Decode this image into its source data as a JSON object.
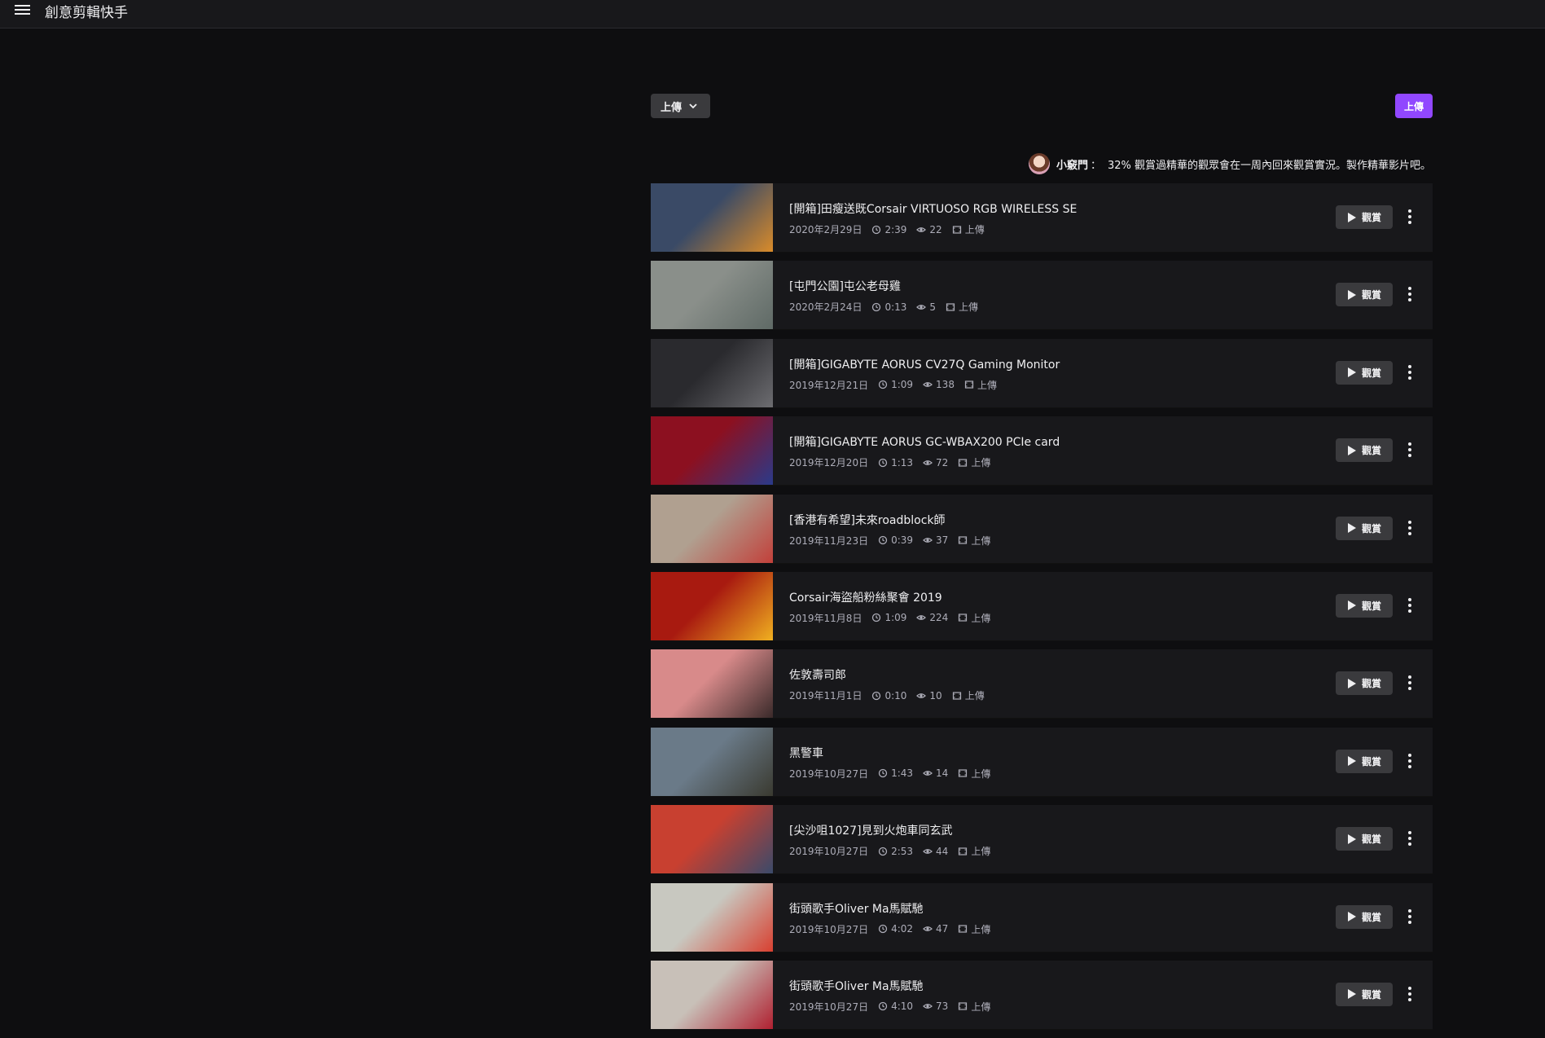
{
  "app": {
    "title": "創意剪輯快手"
  },
  "filter": {
    "label": "上傳"
  },
  "upload_button": {
    "label": "上傳"
  },
  "tip": {
    "name": "小竅門",
    "separator": "：",
    "text": "32% 觀賞過精華的觀眾會在一周內回來觀賞實況。製作精華影片吧。"
  },
  "videos": [
    {
      "title": "[開箱]田瘦送既Corsair VIRTUOSO RGB WIRELESS SE",
      "date": "2020年2月29日",
      "duration": "2:39",
      "views": "22",
      "type": "上傳",
      "watch_label": "觀賞"
    },
    {
      "title": "[屯門公園]屯公老母雞",
      "date": "2020年2月24日",
      "duration": "0:13",
      "views": "5",
      "type": "上傳",
      "watch_label": "觀賞"
    },
    {
      "title": "[開箱]GIGABYTE AORUS CV27Q Gaming Monitor",
      "date": "2019年12月21日",
      "duration": "1:09",
      "views": "138",
      "type": "上傳",
      "watch_label": "觀賞"
    },
    {
      "title": "[開箱]GIGABYTE AORUS GC-WBAX200 PCIe card",
      "date": "2019年12月20日",
      "duration": "1:13",
      "views": "72",
      "type": "上傳",
      "watch_label": "觀賞"
    },
    {
      "title": "[香港有希望]未來roadblock師",
      "date": "2019年11月23日",
      "duration": "0:39",
      "views": "37",
      "type": "上傳",
      "watch_label": "觀賞"
    },
    {
      "title": "Corsair海盜船粉絲聚會 2019",
      "date": "2019年11月8日",
      "duration": "1:09",
      "views": "224",
      "type": "上傳",
      "watch_label": "觀賞"
    },
    {
      "title": "佐敦壽司郎",
      "date": "2019年11月1日",
      "duration": "0:10",
      "views": "10",
      "type": "上傳",
      "watch_label": "觀賞"
    },
    {
      "title": "黑警車",
      "date": "2019年10月27日",
      "duration": "1:43",
      "views": "14",
      "type": "上傳",
      "watch_label": "觀賞"
    },
    {
      "title": "[尖沙咀1027]見到火炮車同玄武",
      "date": "2019年10月27日",
      "duration": "2:53",
      "views": "44",
      "type": "上傳",
      "watch_label": "觀賞"
    },
    {
      "title": "街頭歌手Oliver Ma馬賦馳",
      "date": "2019年10月27日",
      "duration": "4:02",
      "views": "47",
      "type": "上傳",
      "watch_label": "觀賞"
    },
    {
      "title": "街頭歌手Oliver Ma馬賦馳",
      "date": "2019年10月27日",
      "duration": "4:10",
      "views": "73",
      "type": "上傳",
      "watch_label": "觀賞"
    }
  ],
  "thumbnail_colors": [
    [
      "#3a4a66",
      "#d98b2a"
    ],
    [
      "#8a8f8a",
      "#5f6a66"
    ],
    [
      "#2a2a2e",
      "#6c6c70"
    ],
    [
      "#8c1020",
      "#2a3a8a"
    ],
    [
      "#b0a090",
      "#c2403a"
    ],
    [
      "#a81a10",
      "#f0b020"
    ],
    [
      "#d88a8a",
      "#3a2a2a"
    ],
    [
      "#6a7a88",
      "#3a3a30"
    ],
    [
      "#c84030",
      "#3a4a6a"
    ],
    [
      "#c8c8c0",
      "#d84030"
    ],
    [
      "#c8c0b8",
      "#b02030"
    ]
  ]
}
